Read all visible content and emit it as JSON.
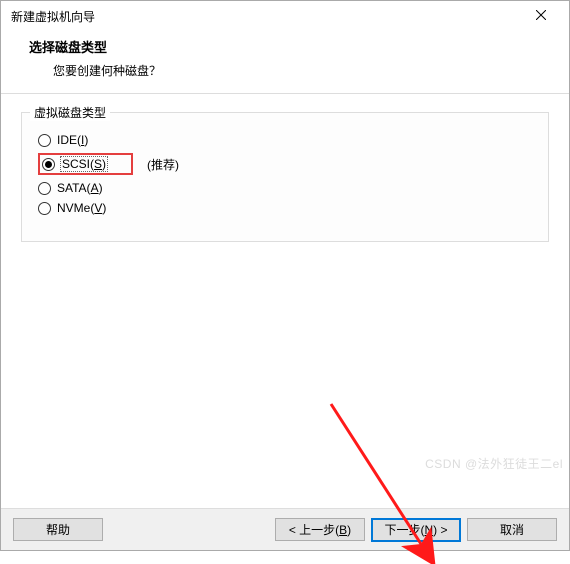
{
  "window": {
    "title": "新建虚拟机向导"
  },
  "header": {
    "title": "选择磁盘类型",
    "subtitle": "您要创建何种磁盘？"
  },
  "fieldset": {
    "legend": "虚拟磁盘类型",
    "options": {
      "ide": {
        "label_prefix": "IDE(",
        "mnemonic": "I",
        "label_suffix": ")"
      },
      "scsi": {
        "label_prefix": "SCSI(",
        "mnemonic": "S",
        "label_suffix": ")",
        "recommend": "(推荐)"
      },
      "sata": {
        "label_prefix": "SATA(",
        "mnemonic": "A",
        "label_suffix": ")"
      },
      "nvme": {
        "label_prefix": "NVMe(",
        "mnemonic": "V",
        "label_suffix": ")"
      }
    }
  },
  "footer": {
    "help": "帮助",
    "back_prefix": "< 上一步(",
    "back_mnemonic": "B",
    "back_suffix": ")",
    "next_prefix": "下一步(",
    "next_mnemonic": "N",
    "next_suffix": ") >",
    "cancel": "取消"
  },
  "watermark": "CSDN @法外狂徒王二el"
}
